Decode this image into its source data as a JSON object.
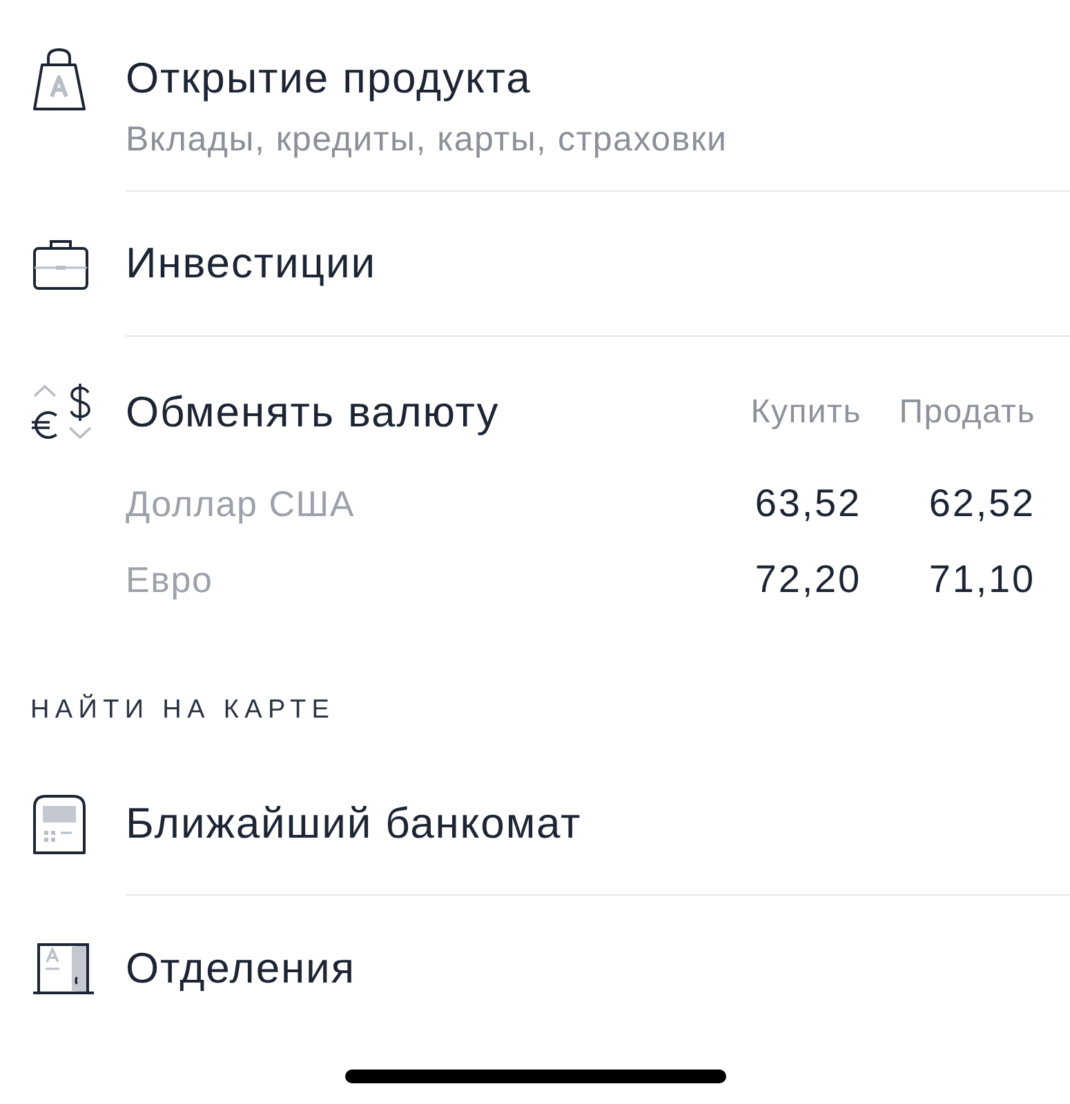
{
  "menu_items": [
    {
      "kind": "bag",
      "title": "Открытие продукта",
      "subtitle": "Вклады, кредиты, карты, страховки"
    },
    {
      "kind": "briefcase",
      "title": "Инвестиции"
    }
  ],
  "currency_exchange": {
    "title": "Обменять валюту",
    "columns": [
      "Купить",
      "Продать"
    ],
    "rows": [
      {
        "name": "Доллар США",
        "buy": "63,52",
        "sell": "62,52"
      },
      {
        "name": "Евро",
        "buy": "72,20",
        "sell": "71,10"
      }
    ]
  },
  "map_section": {
    "header": "НАЙТИ НА КАРТЕ",
    "items": [
      {
        "kind": "atm",
        "title": "Ближайший банкомат"
      },
      {
        "kind": "branch",
        "title": "Отделения"
      }
    ]
  }
}
